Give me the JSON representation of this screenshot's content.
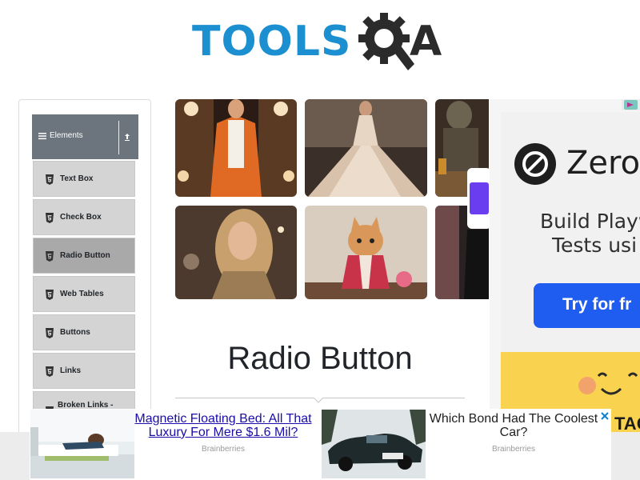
{
  "logo": {
    "primary_text": "TOOLS",
    "secondary_text": "A",
    "icon": "gear-q-icon",
    "brand_color": "#1b8fcf"
  },
  "sidebar": {
    "group_title": "Elements",
    "group_icon": "hamburger-icon",
    "collapse_icon": "collapse-arrow-icon",
    "items": [
      {
        "label": "Text Box",
        "icon": "html5-icon",
        "active": false
      },
      {
        "label": "Check Box",
        "icon": "html5-icon",
        "active": false
      },
      {
        "label": "Radio Button",
        "icon": "html5-icon",
        "active": true
      },
      {
        "label": "Web Tables",
        "icon": "html5-icon",
        "active": false
      },
      {
        "label": "Buttons",
        "icon": "html5-icon",
        "active": false
      },
      {
        "label": "Links",
        "icon": "html5-icon",
        "active": false
      },
      {
        "label": "Broken Links -",
        "icon": "html5-icon",
        "active": false
      }
    ]
  },
  "main": {
    "page_title": "Radio Button"
  },
  "right_ad": {
    "brand": "Zero",
    "body_line1": "Build Playw",
    "body_line2": "Tests usi",
    "cta": "Try for fr",
    "footer_text": "TAG",
    "accent": "#1f5cf0",
    "footer_bg": "#f9d34f"
  },
  "bottom_ads": [
    {
      "headline": "Magnetic Floating Bed: All That Luxury For Mere $1.6 Mil?",
      "line1": "Magnetic Floating Bed: All That",
      "line2": "Luxury For Mere $1.6 Mil?",
      "source": "Brainberries"
    },
    {
      "headline": "Which Bond Had The Coolest Car?",
      "line1": "Which Bond Had The Coolest",
      "line2": "Car?",
      "source": "Brainberries"
    }
  ]
}
